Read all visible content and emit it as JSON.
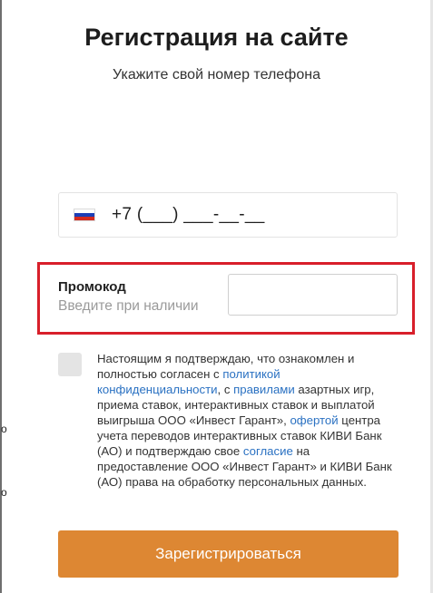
{
  "page": {
    "title": "Регистрация на сайте",
    "subtitle": "Укажите свой номер телефона"
  },
  "phone": {
    "country_icon": "russia-flag-icon",
    "mask": "+7 (___) ___-__-__"
  },
  "promo": {
    "label": "Промокод",
    "hint": "Введите при наличии",
    "value": "",
    "highlight_color": "#d81f2a"
  },
  "consent": {
    "checked": false,
    "t1": "Настоящим я подтверждаю, что ознакомлен и полностью согласен с ",
    "link_policy": "политикой конфиденциальности",
    "t2": ", с ",
    "link_rules": "правилами",
    "t3": " азартных игр, приема ставок, интерактивных ставок и выплатой выигрыша ООО «Инвест Гарант», ",
    "link_offer": "офертой",
    "t4": " центра учета переводов интерактивных ставок КИВИ Банк (АО) и подтверждаю свое ",
    "link_consent": "согласие",
    "t5": " на предоставление ООО «Инвест Гарант» и КИВИ Банк (АО) права на обработку персональных данных."
  },
  "register_button": {
    "label": "Зарегистрироваться",
    "color": "#dd8733"
  },
  "side_marks": [
    "о",
    "о"
  ],
  "colors": {
    "link": "#2a71c2",
    "checkbox_bg": "#e4e4e4"
  }
}
